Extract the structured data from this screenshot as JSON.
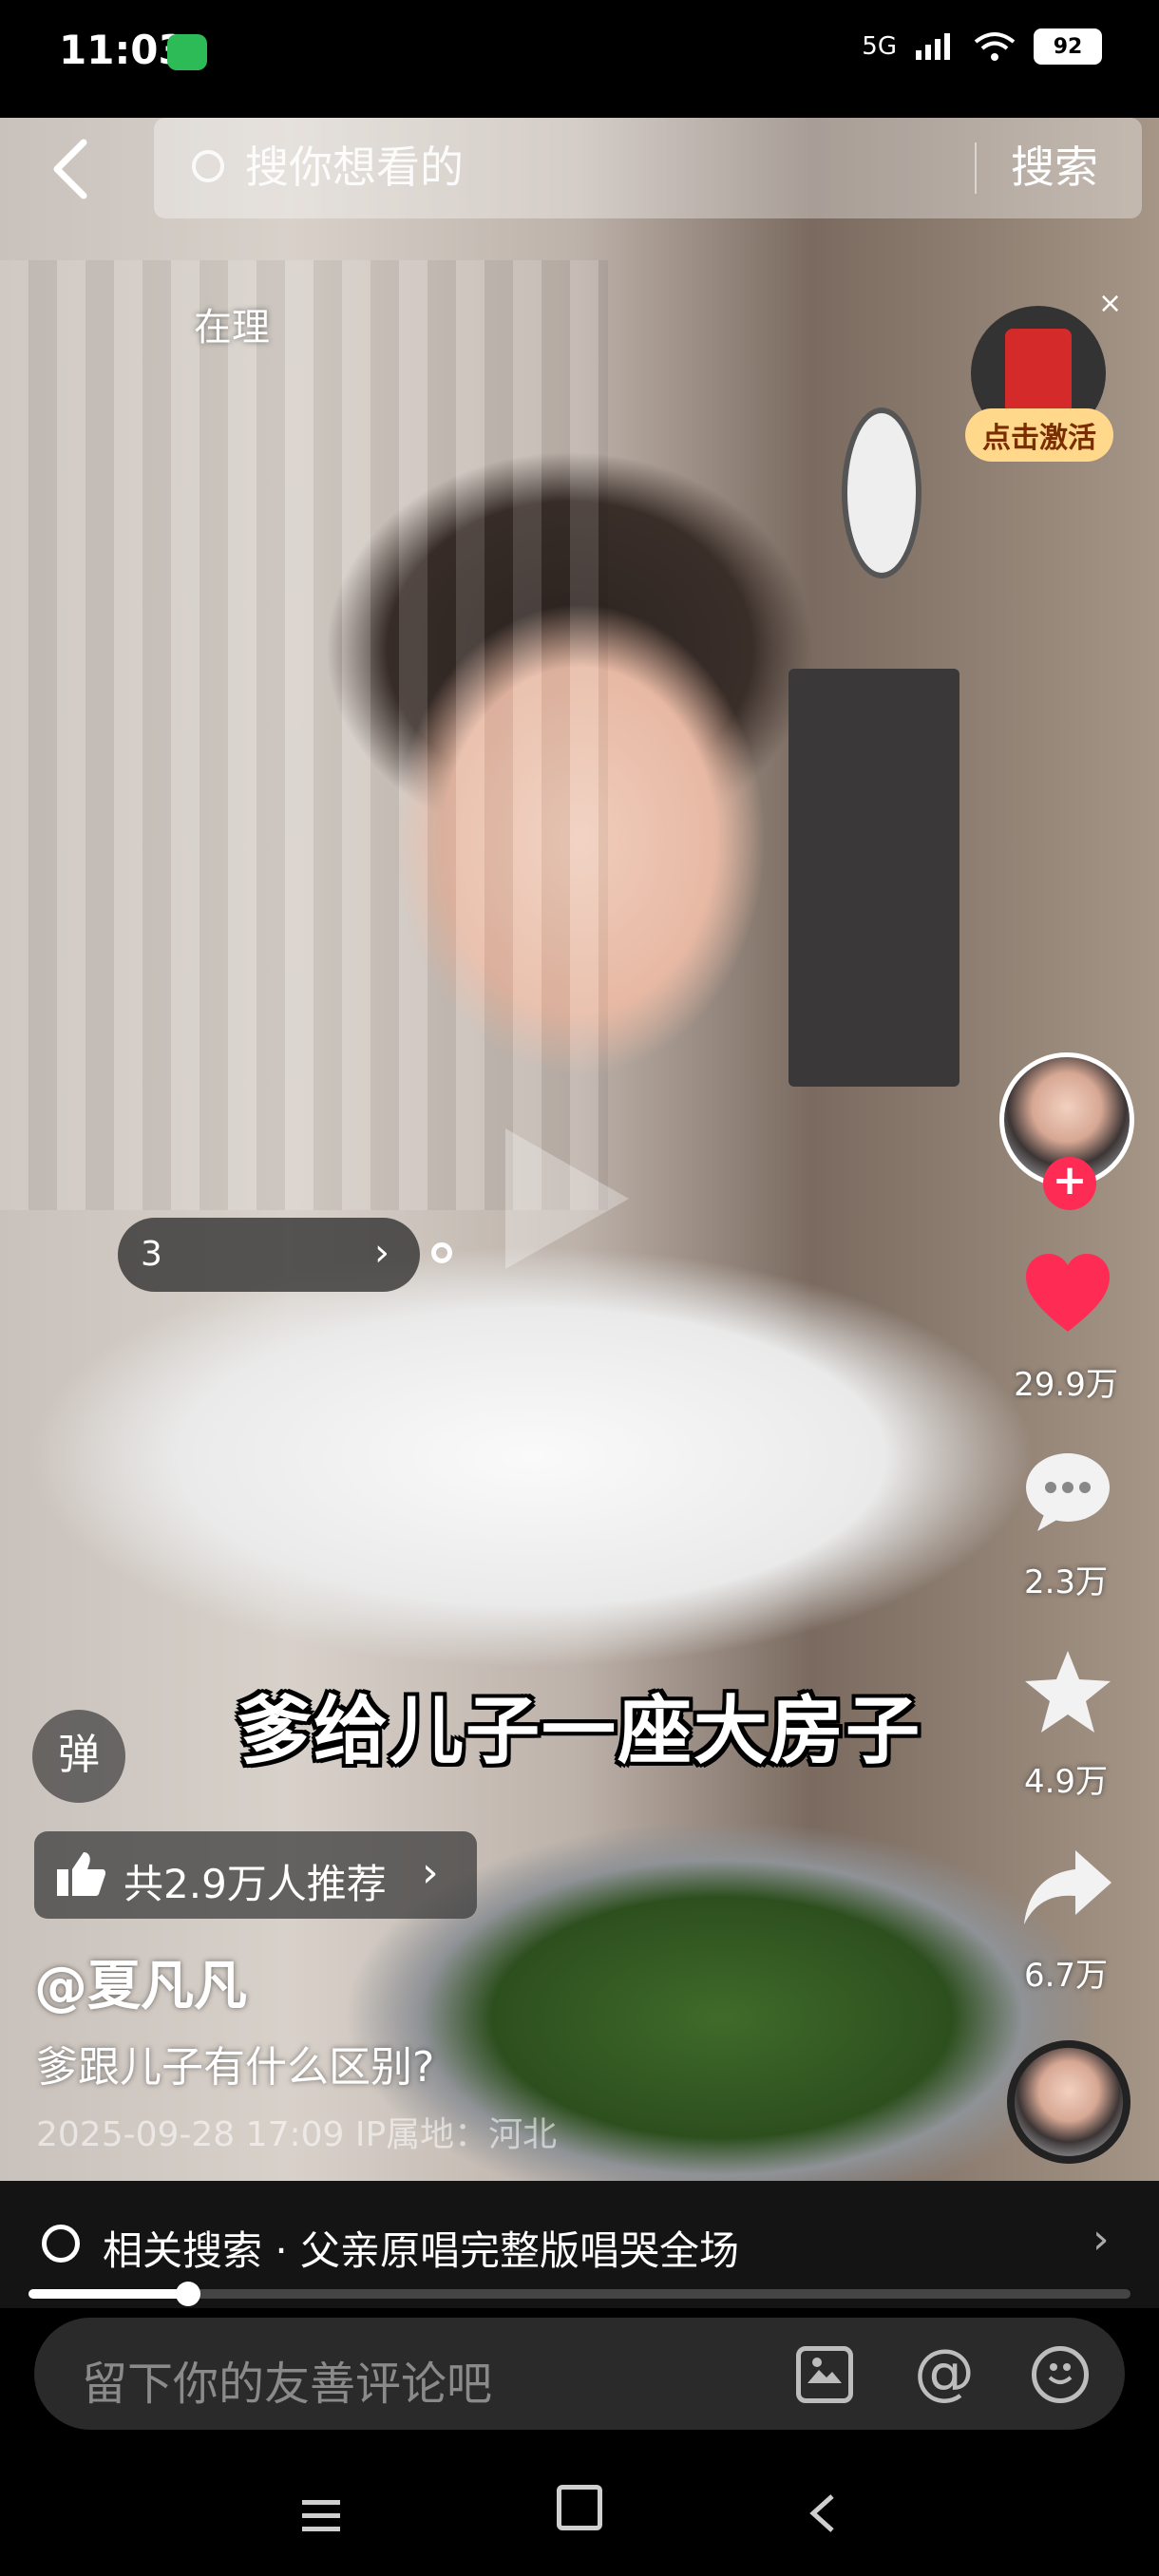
{
  "status_bar": {
    "time": "11:03",
    "network": "5G",
    "battery": "92"
  },
  "search": {
    "placeholder": "搜你想看的",
    "button": "搜索"
  },
  "video": {
    "location_tag": "在理",
    "red_packet": {
      "button": "点击激活",
      "close": "×"
    },
    "pill_text": "3",
    "subtitle": "爹给儿子一座大房子"
  },
  "actions": {
    "like_count": "29.9万",
    "comment_count": "2.3万",
    "favorite_count": "4.9万",
    "share_count": "6.7万"
  },
  "overlay": {
    "danmu_label": "弹",
    "recommend_text": "共2.9万人推荐",
    "author": "@夏凡凡",
    "description": "爹跟儿子有什么区别?",
    "meta": "2025-09-28 17:09   IP属地：河北"
  },
  "related_search": {
    "text": "相关搜索 · 父亲原唱完整版唱哭全场"
  },
  "progress": {
    "fraction": 0.145
  },
  "comment_bar": {
    "placeholder": "留下你的友善评论吧"
  },
  "icons": {
    "back": "chevron-left-icon",
    "like": "heart-icon",
    "comment": "speech-bubble-icon",
    "favorite": "star-icon",
    "share": "share-arrow-icon"
  },
  "colors": {
    "like": "#fe2c55",
    "follow": "#fe2c55",
    "red_packet_button": "#ffd88c"
  }
}
